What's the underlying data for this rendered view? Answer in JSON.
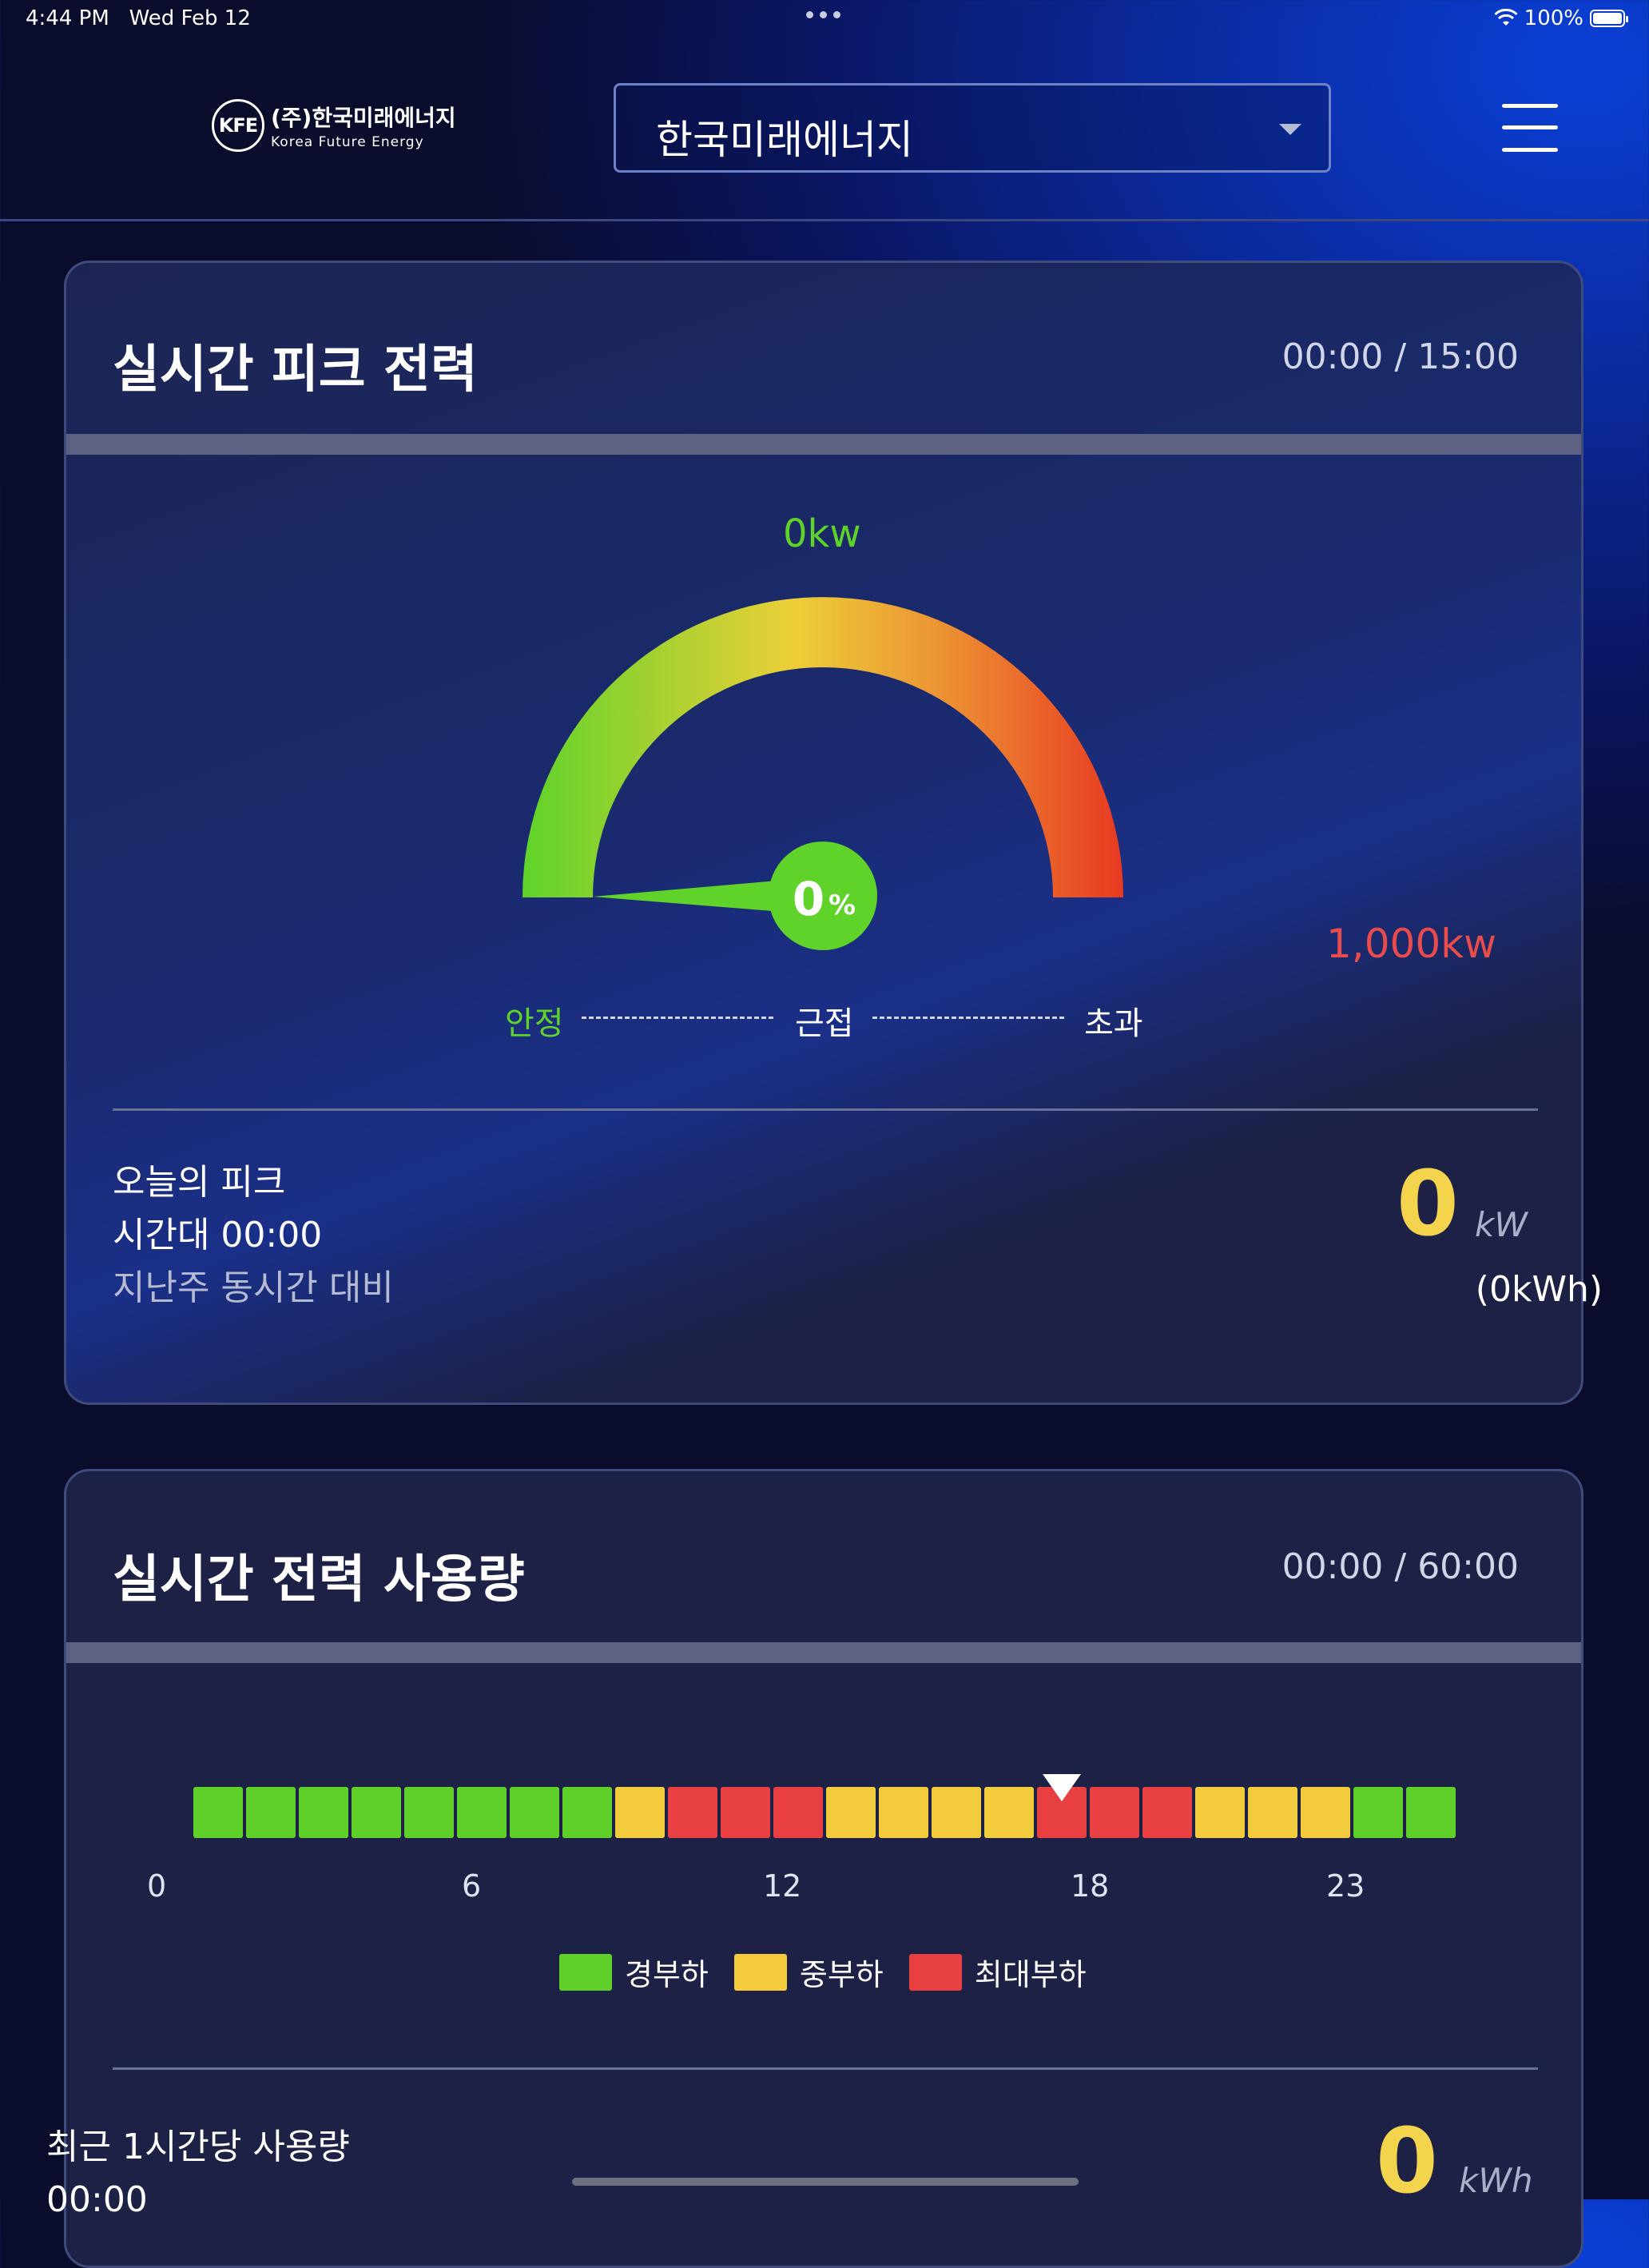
{
  "status_bar": {
    "time": "4:44 PM",
    "date": "Wed Feb 12",
    "battery": "100%"
  },
  "header": {
    "logo_mark": "KFE",
    "logo_ko": "(주)한국미래에너지",
    "logo_en": "Korea Future Energy",
    "selected_company": "한국미래에너지",
    "menu_icon": "hamburger-menu-icon"
  },
  "peak_card": {
    "title": "실시간 피크 전력",
    "time": "00:00 / 15:00",
    "current_kw": "0kw",
    "max_kw": "1,000kw",
    "percent_value": "0",
    "percent_sign": "%",
    "percent": 0,
    "scale_labels": [
      "안정",
      "근접",
      "초과"
    ],
    "today_peak_label": "오늘의 피크",
    "time_slot_label": "시간대 00:00",
    "compare_label": "지난주 동시간 대비",
    "peak_value": "0",
    "peak_unit": "kW",
    "peak_kwh": "(0kWh)"
  },
  "usage_card": {
    "title": "실시간 전력 사용량",
    "time": "00:00 / 60:00",
    "hour_levels": [
      "light",
      "light",
      "light",
      "light",
      "light",
      "light",
      "light",
      "light",
      "mid",
      "peak",
      "peak",
      "peak",
      "mid",
      "mid",
      "mid",
      "mid",
      "peak",
      "peak",
      "peak",
      "mid",
      "mid",
      "mid",
      "light",
      "light"
    ],
    "current_hour_index": 16,
    "ticks": [
      "0",
      "6",
      "12",
      "18",
      "23"
    ],
    "legend": [
      {
        "key": "light",
        "label": "경부하",
        "color": "#5fcf2a"
      },
      {
        "key": "mid",
        "label": "중부하",
        "color": "#f2cc3c"
      },
      {
        "key": "peak",
        "label": "최대부하",
        "color": "#e83f41"
      }
    ],
    "recent_label": "최근 1시간당 사용량",
    "recent_time": "00:00",
    "usage_value": "0",
    "usage_unit": "kWh"
  }
}
